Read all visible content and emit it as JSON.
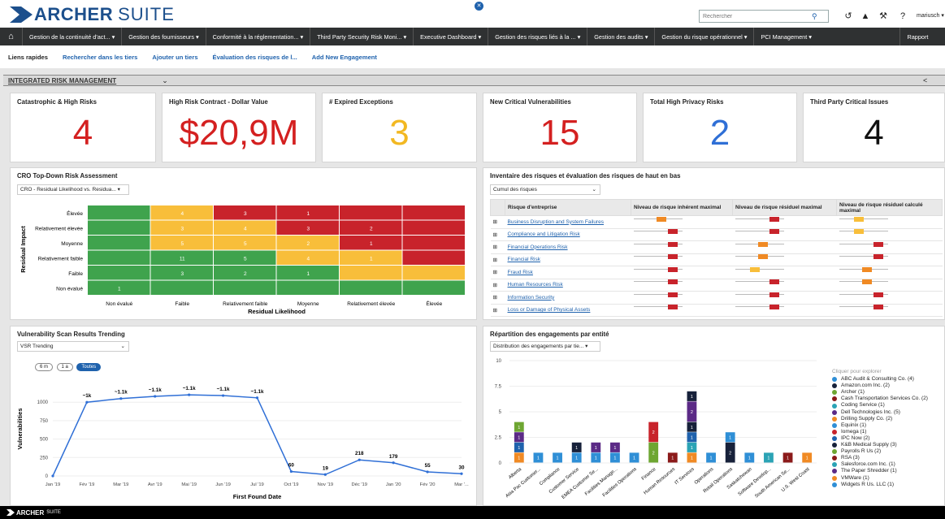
{
  "app": {
    "brand_bold": "ARCHER",
    "brand_suite": "SUITE",
    "search_placeholder": "Rechercher",
    "user": "mariusch ▾"
  },
  "nav": [
    "Gestion de la continuité d'act... ▾",
    "Gestion des fournisseurs ▾",
    "Conformité à la réglementation... ▾",
    "Third Party Security Risk Moni... ▾",
    "Executive Dashboard ▾",
    "Gestion des risques liés à la ... ▾",
    "Gestion des audits ▾",
    "Gestion du risque opérationnel ▾",
    "PCI Management ▾",
    "Rapport"
  ],
  "quick": {
    "label": "Liens rapides",
    "links": [
      "Rechercher dans les tiers",
      "Ajouter un tiers",
      "Évaluation des risques de l...",
      "Add New Engagement"
    ]
  },
  "dashboard": {
    "title": "INTEGRATED RISK MANAGEMENT",
    "dropdown": "⌄"
  },
  "kpis": [
    {
      "title": "Catastrophic & High Risks",
      "value": "4",
      "color": "#d42020"
    },
    {
      "title": "High Risk Contract - Dollar Value",
      "value": "$20,9M",
      "color": "#d42020"
    },
    {
      "title": "# Expired Exceptions",
      "value": "3",
      "color": "#f2b822"
    },
    {
      "title": "New Critical Vulnerabilities",
      "value": "15",
      "color": "#d42020"
    },
    {
      "title": "Total High Privacy Risks",
      "value": "2",
      "color": "#2f6fd6"
    },
    {
      "title": "Third Party Critical Issues",
      "value": "4",
      "color": "#111111"
    }
  ],
  "heatmap": {
    "title": "CRO Top-Down Risk Assessment",
    "select": "CRO - Residual Likelihood vs. Residua... ▾",
    "ylabel": "Residual Impact",
    "xlabel": "Residual Likelihood",
    "rows": [
      "Élevée",
      "Relativement élevée",
      "Moyenne",
      "Relativement faible",
      "Faible",
      "Non évalué"
    ],
    "cols": [
      "Non évalué",
      "Faible",
      "Relativement faible",
      "Moyenne",
      "Relativement élevée",
      "Élevée"
    ],
    "colors": [
      [
        "g",
        "y",
        "r",
        "r",
        "r",
        "r"
      ],
      [
        "g",
        "y",
        "y",
        "r",
        "r",
        "r"
      ],
      [
        "g",
        "y",
        "y",
        "y",
        "r",
        "r"
      ],
      [
        "g",
        "g",
        "g",
        "y",
        "y",
        "r"
      ],
      [
        "g",
        "g",
        "g",
        "g",
        "y",
        "y"
      ],
      [
        "g",
        "g",
        "g",
        "g",
        "g",
        "g"
      ]
    ],
    "values": [
      [
        "",
        "4",
        "3",
        "1",
        "",
        ""
      ],
      [
        "",
        "3",
        "4",
        "3",
        "2",
        ""
      ],
      [
        "",
        "5",
        "5",
        "2",
        "1",
        ""
      ],
      [
        "",
        "11",
        "5",
        "4",
        "1",
        ""
      ],
      [
        "",
        "3",
        "2",
        "1",
        "",
        ""
      ],
      [
        "1",
        "",
        "",
        "",
        "",
        ""
      ]
    ],
    "palette": {
      "g": "#3fa34d",
      "y": "#f8be3a",
      "r": "#c8232b"
    }
  },
  "inventory": {
    "title": "Inventaire des risques et évaluation des risques de haut en bas",
    "select": "Cumul des risques",
    "headers": [
      "Risque d'entreprise",
      "Niveau de risque inhérent maximal",
      "Niveau de risque résiduel maximal",
      "Niveau de risque résiduel calculé maximal"
    ],
    "rows": [
      {
        "name": "Business Disruption and System Failures",
        "a": "orange",
        "b": "red",
        "c": "yellow"
      },
      {
        "name": "Compliance and Litigation Risk",
        "a": "red",
        "b": "red",
        "c": "yellow"
      },
      {
        "name": "Financial Operations Risk",
        "a": "red",
        "b": "orange",
        "c": "red"
      },
      {
        "name": "Financial Risk",
        "a": "red",
        "b": "orange",
        "c": "red"
      },
      {
        "name": "Fraud Risk",
        "a": "red",
        "b": "yellow",
        "c": "orange"
      },
      {
        "name": "Human Resources Risk",
        "a": "red",
        "b": "red",
        "c": "orange"
      },
      {
        "name": "Information Security",
        "a": "red",
        "b": "red",
        "c": "red"
      },
      {
        "name": "Loss or Damage of Physical Assets",
        "a": "red",
        "b": "red",
        "c": "red"
      }
    ],
    "levelColors": {
      "red": "#c8232b",
      "orange": "#f08a24",
      "yellow": "#f8be3a"
    }
  },
  "chart_data": [
    {
      "type": "line",
      "title": "Vulnerability Scan Results Trending",
      "ylabel": "Vulnerabilities",
      "xlabel": "First Found Date",
      "x": [
        "Jan '19",
        "Fév '19",
        "Mar '19",
        "Avr '19",
        "Mai '19",
        "Jun '19",
        "Jul '19",
        "Oct '19",
        "Nov '19",
        "Déc '19",
        "Jan '20",
        "Fév '20",
        "Mar '..."
      ],
      "values": [
        0,
        1000,
        1050,
        1080,
        1100,
        1090,
        1060,
        60,
        19,
        218,
        179,
        55,
        30
      ],
      "labels": [
        "",
        "~1k",
        "~1.1k",
        "~1.1k",
        "~1.1k",
        "~1.1k",
        "~1.1k",
        "60",
        "19",
        "218",
        "179",
        "55",
        "30"
      ],
      "yticks": [
        0,
        250,
        500,
        750,
        1000
      ],
      "ylim": [
        0,
        1300
      ],
      "select": "VSR Trending",
      "ranges": [
        "6 m",
        "1 a",
        "Toutes"
      ],
      "color": "#2f6fd6"
    },
    {
      "type": "bar",
      "title": "Répartition des engagements par entité",
      "select": "Distribution des engagements par tie... ▾",
      "categories": [
        "Alberta",
        "Asia Pac Customer...",
        "Compliance",
        "Customer Service",
        "EMEA Customer Se...",
        "Facilities Manage...",
        "Facilities Operations",
        "Finance",
        "Human Resources",
        "IT Services",
        "Operations",
        "Retail Operations",
        "Saskatchewan",
        "Software Develop...",
        "South American Se...",
        "U.S. West Coast"
      ],
      "series_stacks": [
        [
          [
            1,
            "#f08a24"
          ],
          [
            1,
            "#1f62ad"
          ],
          [
            1,
            "#5b2a86"
          ],
          [
            1,
            "#6ea632"
          ]
        ],
        [
          [
            1,
            "#2f8fd6"
          ]
        ],
        [
          [
            1,
            "#2f8fd6"
          ]
        ],
        [
          [
            1,
            "#2f8fd6"
          ],
          [
            1,
            "#17213a"
          ]
        ],
        [
          [
            1,
            "#2f8fd6"
          ],
          [
            1,
            "#5b2a86"
          ]
        ],
        [
          [
            1,
            "#2f8fd6"
          ],
          [
            1,
            "#5b2a86"
          ]
        ],
        [
          [
            1,
            "#2f8fd6"
          ]
        ],
        [
          [
            2,
            "#6ea632"
          ],
          [
            2,
            "#c8232b"
          ]
        ],
        [
          [
            1,
            "#8b1a1a"
          ]
        ],
        [
          [
            1,
            "#f08a24"
          ],
          [
            1,
            "#2ba3b5"
          ],
          [
            1,
            "#1f62ad"
          ],
          [
            1,
            "#17213a"
          ],
          [
            2,
            "#5b2a86"
          ],
          [
            1,
            "#17213a"
          ]
        ],
        [
          [
            1,
            "#2f8fd6"
          ]
        ],
        [
          [
            2,
            "#17213a"
          ],
          [
            1,
            "#2f8fd6"
          ]
        ],
        [
          [
            1,
            "#2f8fd6"
          ]
        ],
        [
          [
            1,
            "#2ba3b5"
          ]
        ],
        [
          [
            1,
            "#8b1a1a"
          ]
        ],
        [
          [
            1,
            "#f08a24"
          ]
        ]
      ],
      "yticks": [
        0,
        2.5,
        5,
        7.5,
        10
      ],
      "ylim": [
        0,
        10
      ],
      "legend_title": "Cliquer pour explorer",
      "legend": [
        {
          "name": "ABC Audit & Consulting Co. (4)",
          "color": "#2f8fd6"
        },
        {
          "name": "Amazon.com Inc. (2)",
          "color": "#17213a"
        },
        {
          "name": "Archer (1)",
          "color": "#6ea632"
        },
        {
          "name": "Cash Transportation Services Co. (2)",
          "color": "#8b1a1a"
        },
        {
          "name": "Coding Service (1)",
          "color": "#2ba3b5"
        },
        {
          "name": "Dell Technologies Inc. (5)",
          "color": "#5b2a86"
        },
        {
          "name": "Drilling Supply Co. (2)",
          "color": "#f08a24"
        },
        {
          "name": "Equinix (1)",
          "color": "#2f8fd6"
        },
        {
          "name": "Iomega (1)",
          "color": "#c8232b"
        },
        {
          "name": "IPC Now (2)",
          "color": "#1f62ad"
        },
        {
          "name": "K&B Medical Supply (3)",
          "color": "#17213a"
        },
        {
          "name": "Payrolls R Us (2)",
          "color": "#6ea632"
        },
        {
          "name": "RSA (3)",
          "color": "#8b1a1a"
        },
        {
          "name": "Salesforce.com Inc. (1)",
          "color": "#2ba3b5"
        },
        {
          "name": "The Paper Shredder (1)",
          "color": "#5b2a86"
        },
        {
          "name": "VMWare (1)",
          "color": "#f08a24"
        },
        {
          "name": "Widgets R Us. LLC (1)",
          "color": "#2f8fd6"
        }
      ]
    }
  ],
  "footer": {
    "brand": "ARCHER",
    "suite": "SUITE"
  }
}
